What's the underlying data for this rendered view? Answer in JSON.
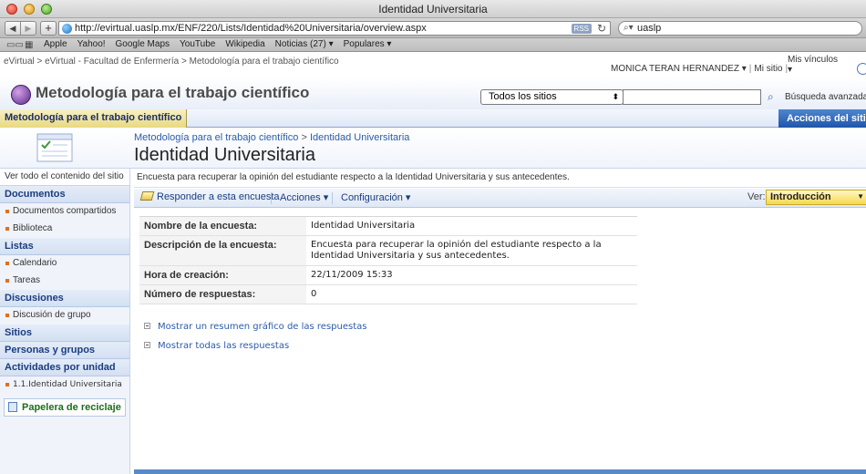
{
  "browser": {
    "window_title": "Identidad Universitaria",
    "url": "http://evirtual.uaslp.mx/ENF/220/Lists/Identidad%20Universitaria/overview.aspx",
    "rss_label": "RSS",
    "search_value": "uaslp",
    "bookmarks": [
      "Apple",
      "Yahoo!",
      "Google Maps",
      "YouTube",
      "Wikipedia",
      "Noticias (27) ▾",
      "Populares ▾"
    ]
  },
  "sp": {
    "global_breadcrumb": "eVirtual > eVirtual - Facultad de Enfermería > Metodología para el trabajo científico",
    "user_name": "MONICA TERAN HERNANDEZ ▾",
    "my_site": "Mi sitio",
    "my_links": "Mis vínculos",
    "site_title": "Metodología para el trabajo científico",
    "search_scope": "Todos los sitios",
    "advanced_search": "Búsqueda avanzada",
    "top_tab": "Metodología para el trabajo científico",
    "site_actions": "Acciones del sitio ▾",
    "crumb_parent": "Metodología para el trabajo científico",
    "crumb_sep": " > ",
    "crumb_current": "Identidad Universitaria",
    "page_title": "Identidad Universitaria"
  },
  "leftnav": {
    "view_all": "Ver todo el contenido del sitio",
    "documents_head": "Documentos",
    "documents": [
      "Documentos compartidos",
      "Biblioteca"
    ],
    "lists_head": "Listas",
    "lists": [
      "Calendario",
      "Tareas"
    ],
    "discussions_head": "Discusiones",
    "discussions": [
      "Discusión de grupo"
    ],
    "sites_head": "Sitios",
    "people_head": "Personas y grupos",
    "activities_head": "Actividades por unidad",
    "activities": [
      "1.1.Identidad Universitaria"
    ],
    "recycle": "Papelera de reciclaje"
  },
  "main": {
    "description": "Encuesta para recuperar la opinión del estudiante respecto a la Identidad Universitaria y sus antecedentes.",
    "respond_label": "Responder a esta encuesta",
    "actions_label": "Acciones ▾",
    "settings_label": "Configuración ▾",
    "view_label": "Ver:",
    "view_value": "Introducción",
    "props": [
      {
        "key": "Nombre de la encuesta:",
        "value": "Identidad Universitaria"
      },
      {
        "key": "Descripción de la encuesta:",
        "value": "Encuesta para recuperar la opinión del estudiante respecto a la Identidad Universitaria y sus antecedentes."
      },
      {
        "key": "Hora de creación:",
        "value": "22/11/2009 15:33"
      },
      {
        "key": "Número de respuestas:",
        "value": "0"
      }
    ],
    "show_graphic": "Mostrar un resumen gráfico de las respuestas",
    "show_all": "Mostrar todas las respuestas"
  }
}
